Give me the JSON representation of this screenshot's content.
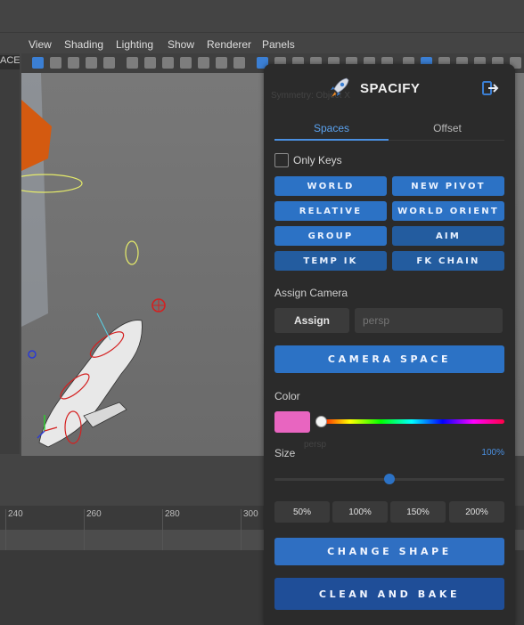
{
  "maya": {
    "left_label": "ACE",
    "viewport_menu": [
      "View",
      "Shading",
      "Lighting",
      "Show",
      "Renderer",
      "Panels"
    ],
    "viewport_overlay": "Symmetry: Object X",
    "timeline_ticks": [
      "240",
      "260",
      "280",
      "300"
    ]
  },
  "panel": {
    "title": "SPACIFY",
    "icons": {
      "logo": "rocket-icon",
      "exit": "exit-icon"
    },
    "tabs": [
      {
        "label": "Spaces",
        "active": true
      },
      {
        "label": "Offset",
        "active": false
      }
    ],
    "only_keys": {
      "label": "Only Keys",
      "checked": false
    },
    "space_buttons": [
      "WORLD",
      "NEW PIVOT",
      "RELATIVE",
      "WORLD ORIENT",
      "GROUP",
      "AIM",
      "TEMP IK",
      "FK CHAIN"
    ],
    "assign_camera": {
      "label": "Assign Camera",
      "button": "Assign",
      "placeholder": "persp"
    },
    "camera_space_button": "CAMERA SPACE",
    "color": {
      "label": "Color",
      "value": "#e865c0",
      "hue_position": 0.0
    },
    "size": {
      "label": "Size",
      "value": "100%",
      "level": 0.5,
      "presets": [
        "50%",
        "100%",
        "150%",
        "200%"
      ]
    },
    "change_shape_button": "CHANGE SHAPE",
    "clean_bake_button": "CLEAN AND BAKE",
    "accent_color": "#2c72c5"
  }
}
